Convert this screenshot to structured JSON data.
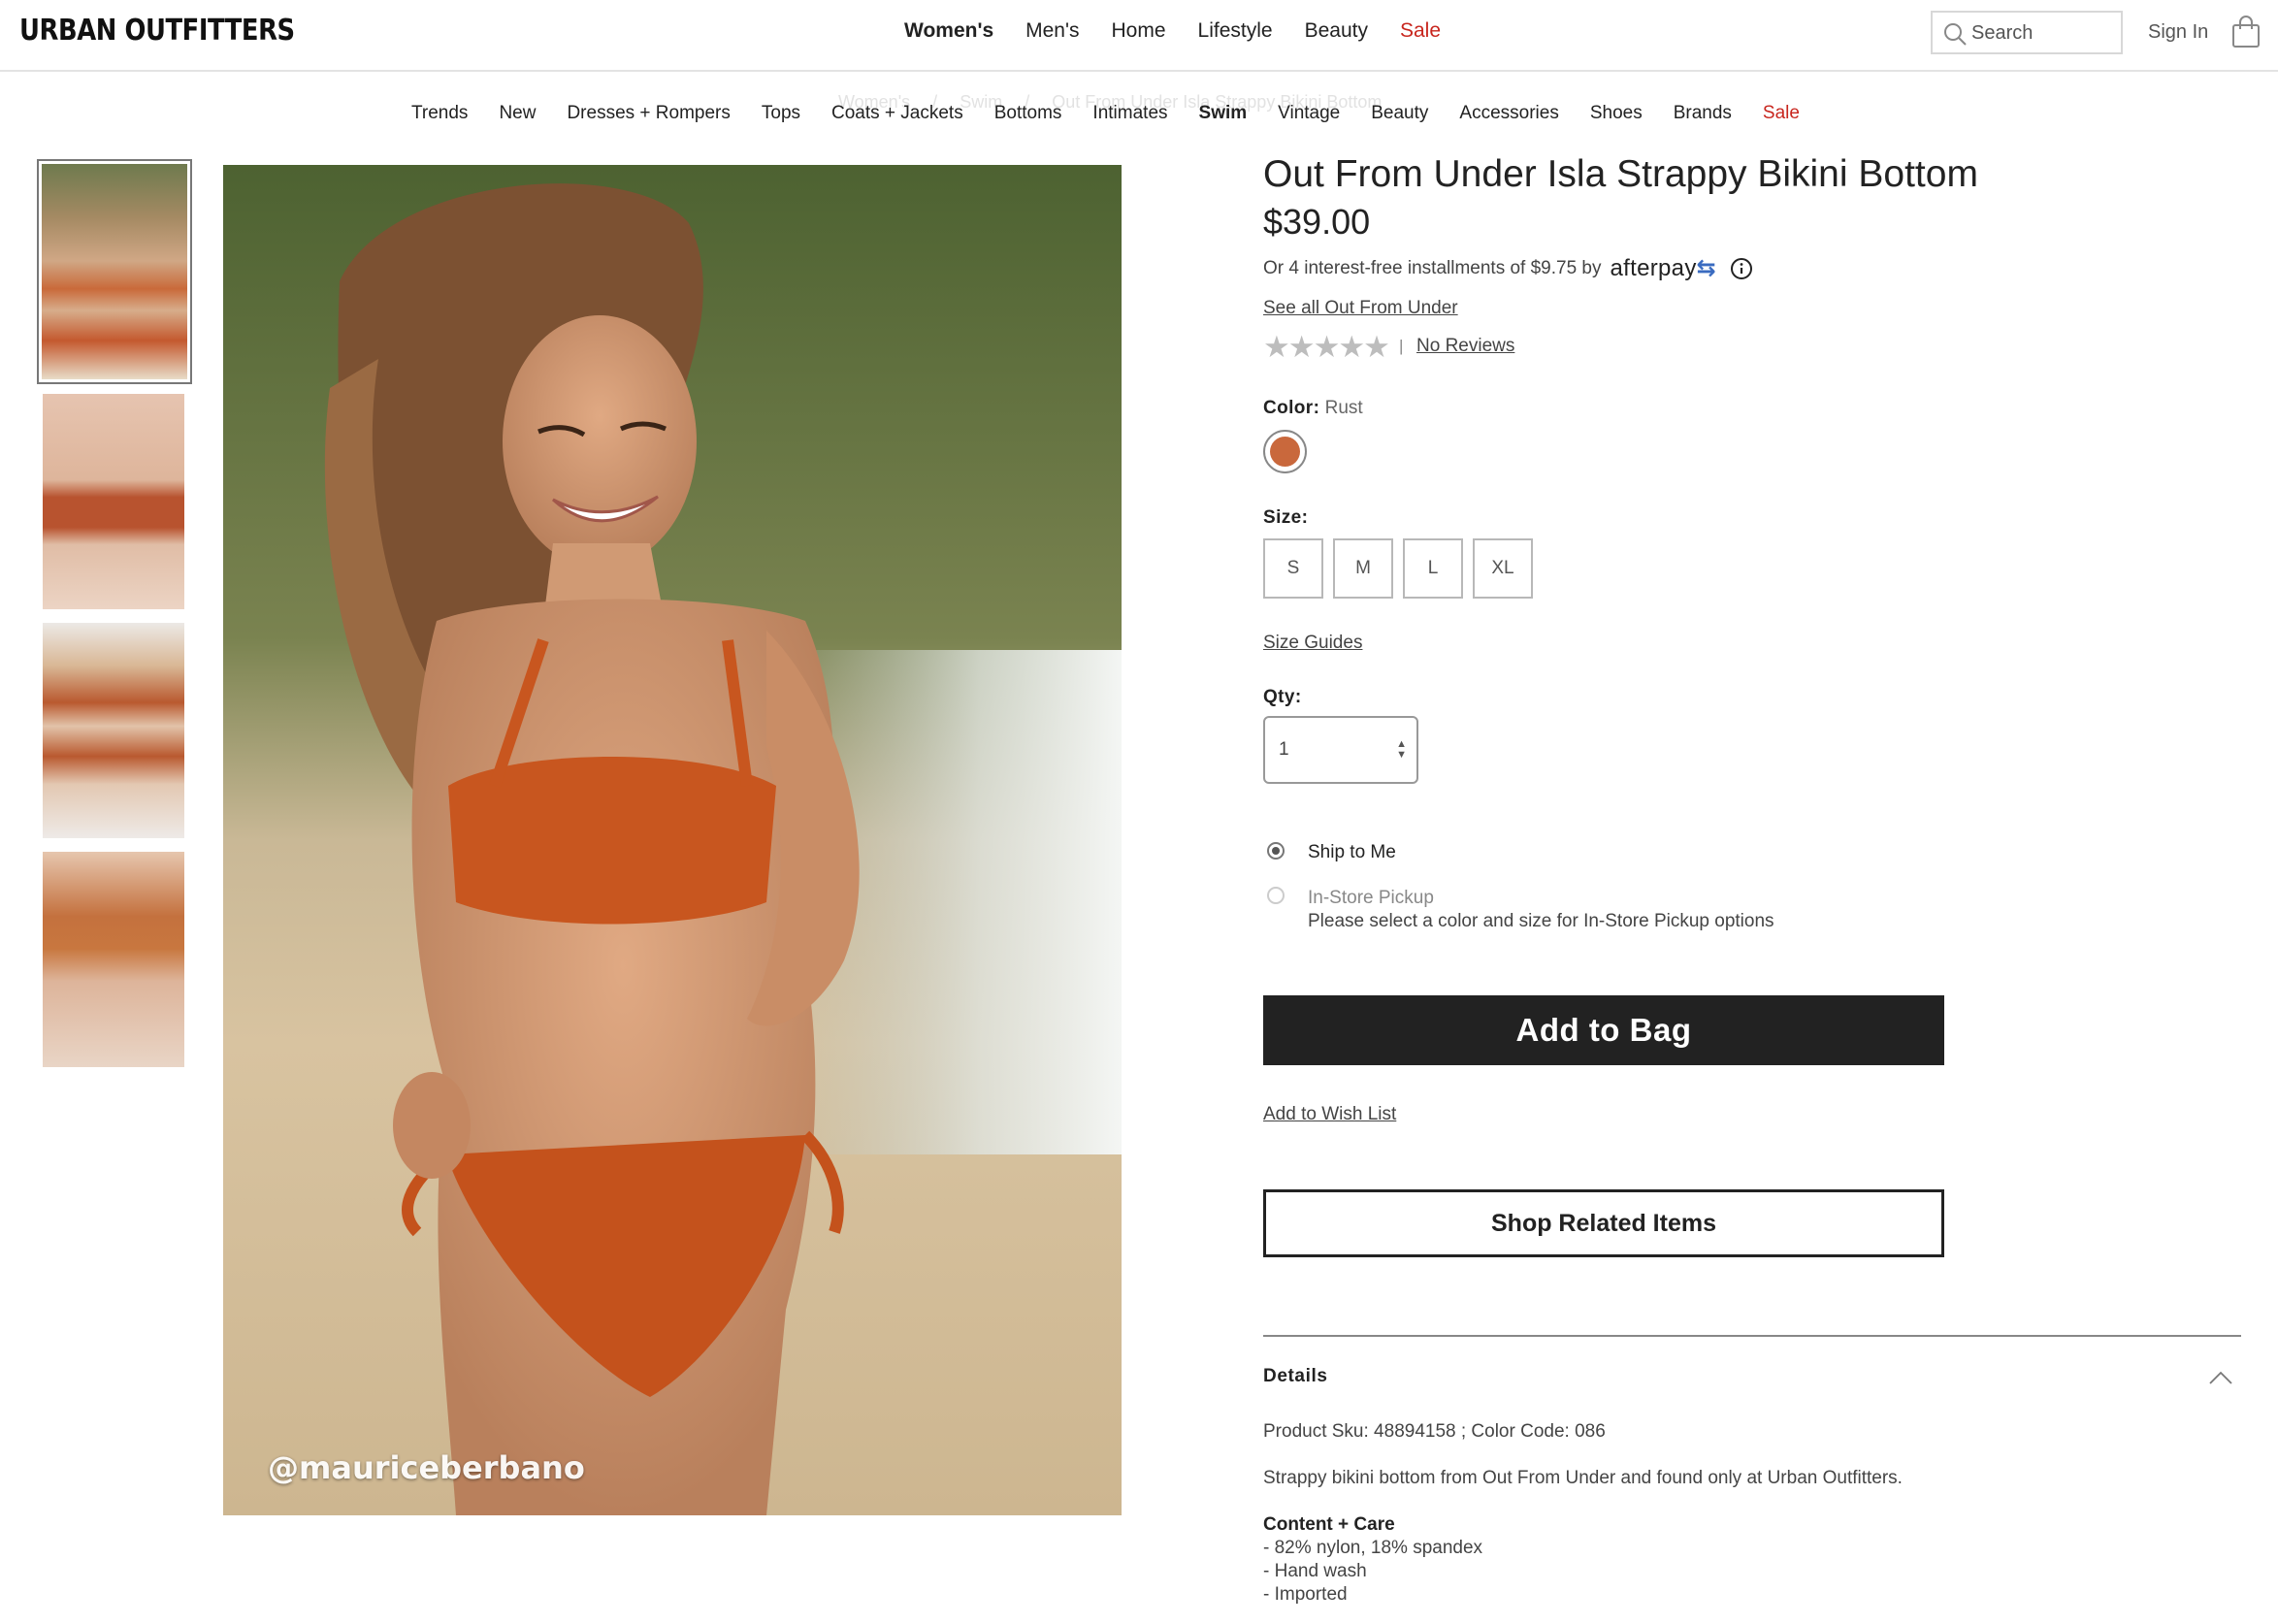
{
  "brand": {
    "logo": "URBAN OUTFITTERS"
  },
  "top_nav": {
    "items": [
      {
        "label": "Women's",
        "bold": true
      },
      {
        "label": "Men's"
      },
      {
        "label": "Home"
      },
      {
        "label": "Lifestyle"
      },
      {
        "label": "Beauty"
      },
      {
        "label": "Sale",
        "sale": true
      }
    ]
  },
  "search": {
    "placeholder": "Search",
    "icon": "search-icon"
  },
  "account": {
    "sign_in": "Sign In",
    "bag_icon": "shopping-bag-icon"
  },
  "breadcrumb": [
    "Women's",
    "/",
    "Swim",
    "/",
    "Out From Under Isla Strappy Bikini Bottom"
  ],
  "category_nav": {
    "items": [
      {
        "label": "Trends"
      },
      {
        "label": "New"
      },
      {
        "label": "Dresses + Rompers"
      },
      {
        "label": "Tops"
      },
      {
        "label": "Coats + Jackets"
      },
      {
        "label": "Bottoms"
      },
      {
        "label": "Intimates"
      },
      {
        "label": "Swim",
        "bold": true
      },
      {
        "label": "Vintage"
      },
      {
        "label": "Beauty"
      },
      {
        "label": "Accessories"
      },
      {
        "label": "Shoes"
      },
      {
        "label": "Brands"
      },
      {
        "label": "Sale",
        "sale": true
      }
    ]
  },
  "gallery": {
    "active_index": 0,
    "watermark": "@mauriceberbano"
  },
  "product": {
    "title": "Out From Under Isla Strappy Bikini Bottom",
    "price": "$39.00",
    "afterpay": {
      "text": "Or 4 interest-free installments of $9.75 by",
      "brand": "afterpay",
      "icon": "info-icon"
    },
    "see_all": "See all Out From Under",
    "rating": {
      "stars": "★★★★★",
      "separator": "|",
      "reviews": "No Reviews"
    },
    "color": {
      "label": "Color:",
      "value": "Rust",
      "swatch_hex": "#c9683c"
    },
    "size": {
      "label": "Size:",
      "options": [
        "S",
        "M",
        "L",
        "XL"
      ]
    },
    "size_guides": "Size Guides",
    "qty": {
      "label": "Qty:",
      "value": "1"
    },
    "fulfillment": {
      "ship": "Ship to Me",
      "pickup": "In-Store Pickup",
      "pickup_note": "Please select a color and size for In-Store Pickup options",
      "selected": "ship"
    },
    "add_to_bag": "Add to Bag",
    "wish_list": "Add to Wish List",
    "related": "Shop Related Items",
    "details": {
      "title": "Details",
      "sku_line": "Product Sku: 48894158 ; Color Code: 086",
      "description": "Strappy bikini bottom from Out From Under and found only at Urban Outfitters.",
      "care_title": "Content + Care",
      "care": [
        "- 82% nylon, 18% spandex",
        "- Hand wash",
        "- Imported"
      ]
    }
  },
  "colors": {
    "accent_sale": "#c8261e",
    "button_dark": "#222222",
    "swim_rust": "#c9683c"
  }
}
